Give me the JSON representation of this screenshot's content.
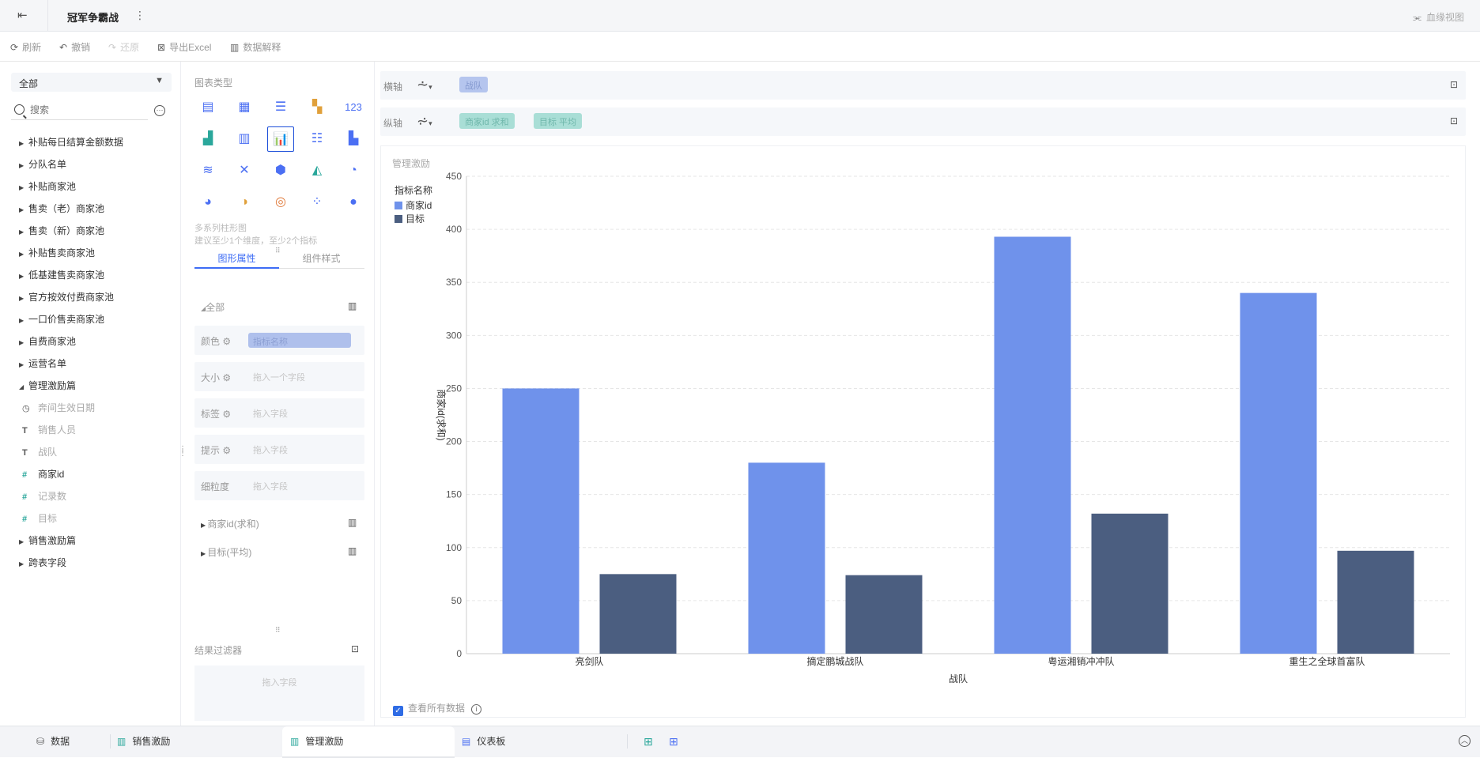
{
  "topbar": {
    "title": "冠军争霸战",
    "view_link": "血缘视图",
    "back_icon": "exit-icon",
    "more_icon": "more-vertical-icon"
  },
  "toolbar": {
    "refresh": "刷新",
    "undo": "撤销",
    "redo": "还原",
    "export": "导出Excel",
    "explain": "数据解释"
  },
  "left": {
    "select": "全部",
    "search_placeholder": "搜索",
    "folders_top": [
      "补贴每日结算金额数据",
      "分队名单",
      "补贴商家池",
      "售卖（老）商家池",
      "售卖（新）商家池",
      "补贴售卖商家池",
      "低基建售卖商家池",
      "官方按效付费商家池",
      "一口价售卖商家池",
      "自费商家池",
      "运营名单"
    ],
    "open_folder": "管理激励篇",
    "fields": [
      {
        "icon": "clock-icon",
        "glyph": "◷",
        "label": "奔间生效日期"
      },
      {
        "icon": "text-field-icon",
        "glyph": "T",
        "label": "销售人员"
      },
      {
        "icon": "text-field-icon",
        "glyph": "T",
        "label": "战队"
      },
      {
        "icon": "number-field-icon",
        "glyph": "#",
        "label": "商家id"
      },
      {
        "icon": "record-count-icon",
        "glyph": "#",
        "label": "记录数"
      },
      {
        "icon": "calc-field-icon",
        "glyph": "#",
        "label": "目标"
      }
    ],
    "folders_bottom": [
      "销售激励篇",
      "跨表字段"
    ]
  },
  "mid": {
    "chart_type_label": "图表类型",
    "hint_line1": "多系列柱形图",
    "hint_line2": "建议至少1个维度，至少2个指标",
    "tab_props": "图形属性",
    "tab_style": "组件样式",
    "section_all": "全部",
    "props": [
      {
        "label": "颜色",
        "value": "指标名称"
      },
      {
        "label": "大小",
        "value": "拖入一个字段"
      },
      {
        "label": "标签",
        "value": "拖入字段"
      },
      {
        "label": "提示",
        "value": "拖入字段"
      },
      {
        "label": "细粒度",
        "value": "拖入字段"
      }
    ],
    "measure1": "商家id(求和)",
    "measure2": "目标(平均)",
    "filter_label": "结果过滤器",
    "filter_drop": "拖入字段"
  },
  "axes": {
    "x_label": "横轴",
    "x_chip": "战队",
    "y_label": "纵轴",
    "y_chips": [
      "商家id 求和",
      "目标 平均"
    ]
  },
  "chart": {
    "panel_title": "管理激励",
    "legend_title": "指标名称",
    "show_all": "查看所有数据"
  },
  "chart_data": {
    "type": "bar",
    "categories": [
      "亮剑队",
      "摘定鹏城战队",
      "粤运湘销冲冲队",
      "重生之全球首富队"
    ],
    "series": [
      {
        "name": "商家id",
        "values": [
          250,
          180,
          393,
          340
        ],
        "color": "#6f92eb"
      },
      {
        "name": "目标",
        "values": [
          75,
          74,
          132,
          97
        ],
        "color": "#4b5e80"
      }
    ],
    "xlabel": "战队",
    "ylabel": "商家id(求和)",
    "ylim": [
      0,
      450
    ],
    "yticks": [
      0,
      50,
      100,
      150,
      200,
      250,
      300,
      350,
      400,
      450
    ],
    "grid": true,
    "legend": "top-left"
  },
  "bottom": {
    "tabs": [
      "数据",
      "销售激励",
      "管理激励",
      "仪表板"
    ]
  }
}
